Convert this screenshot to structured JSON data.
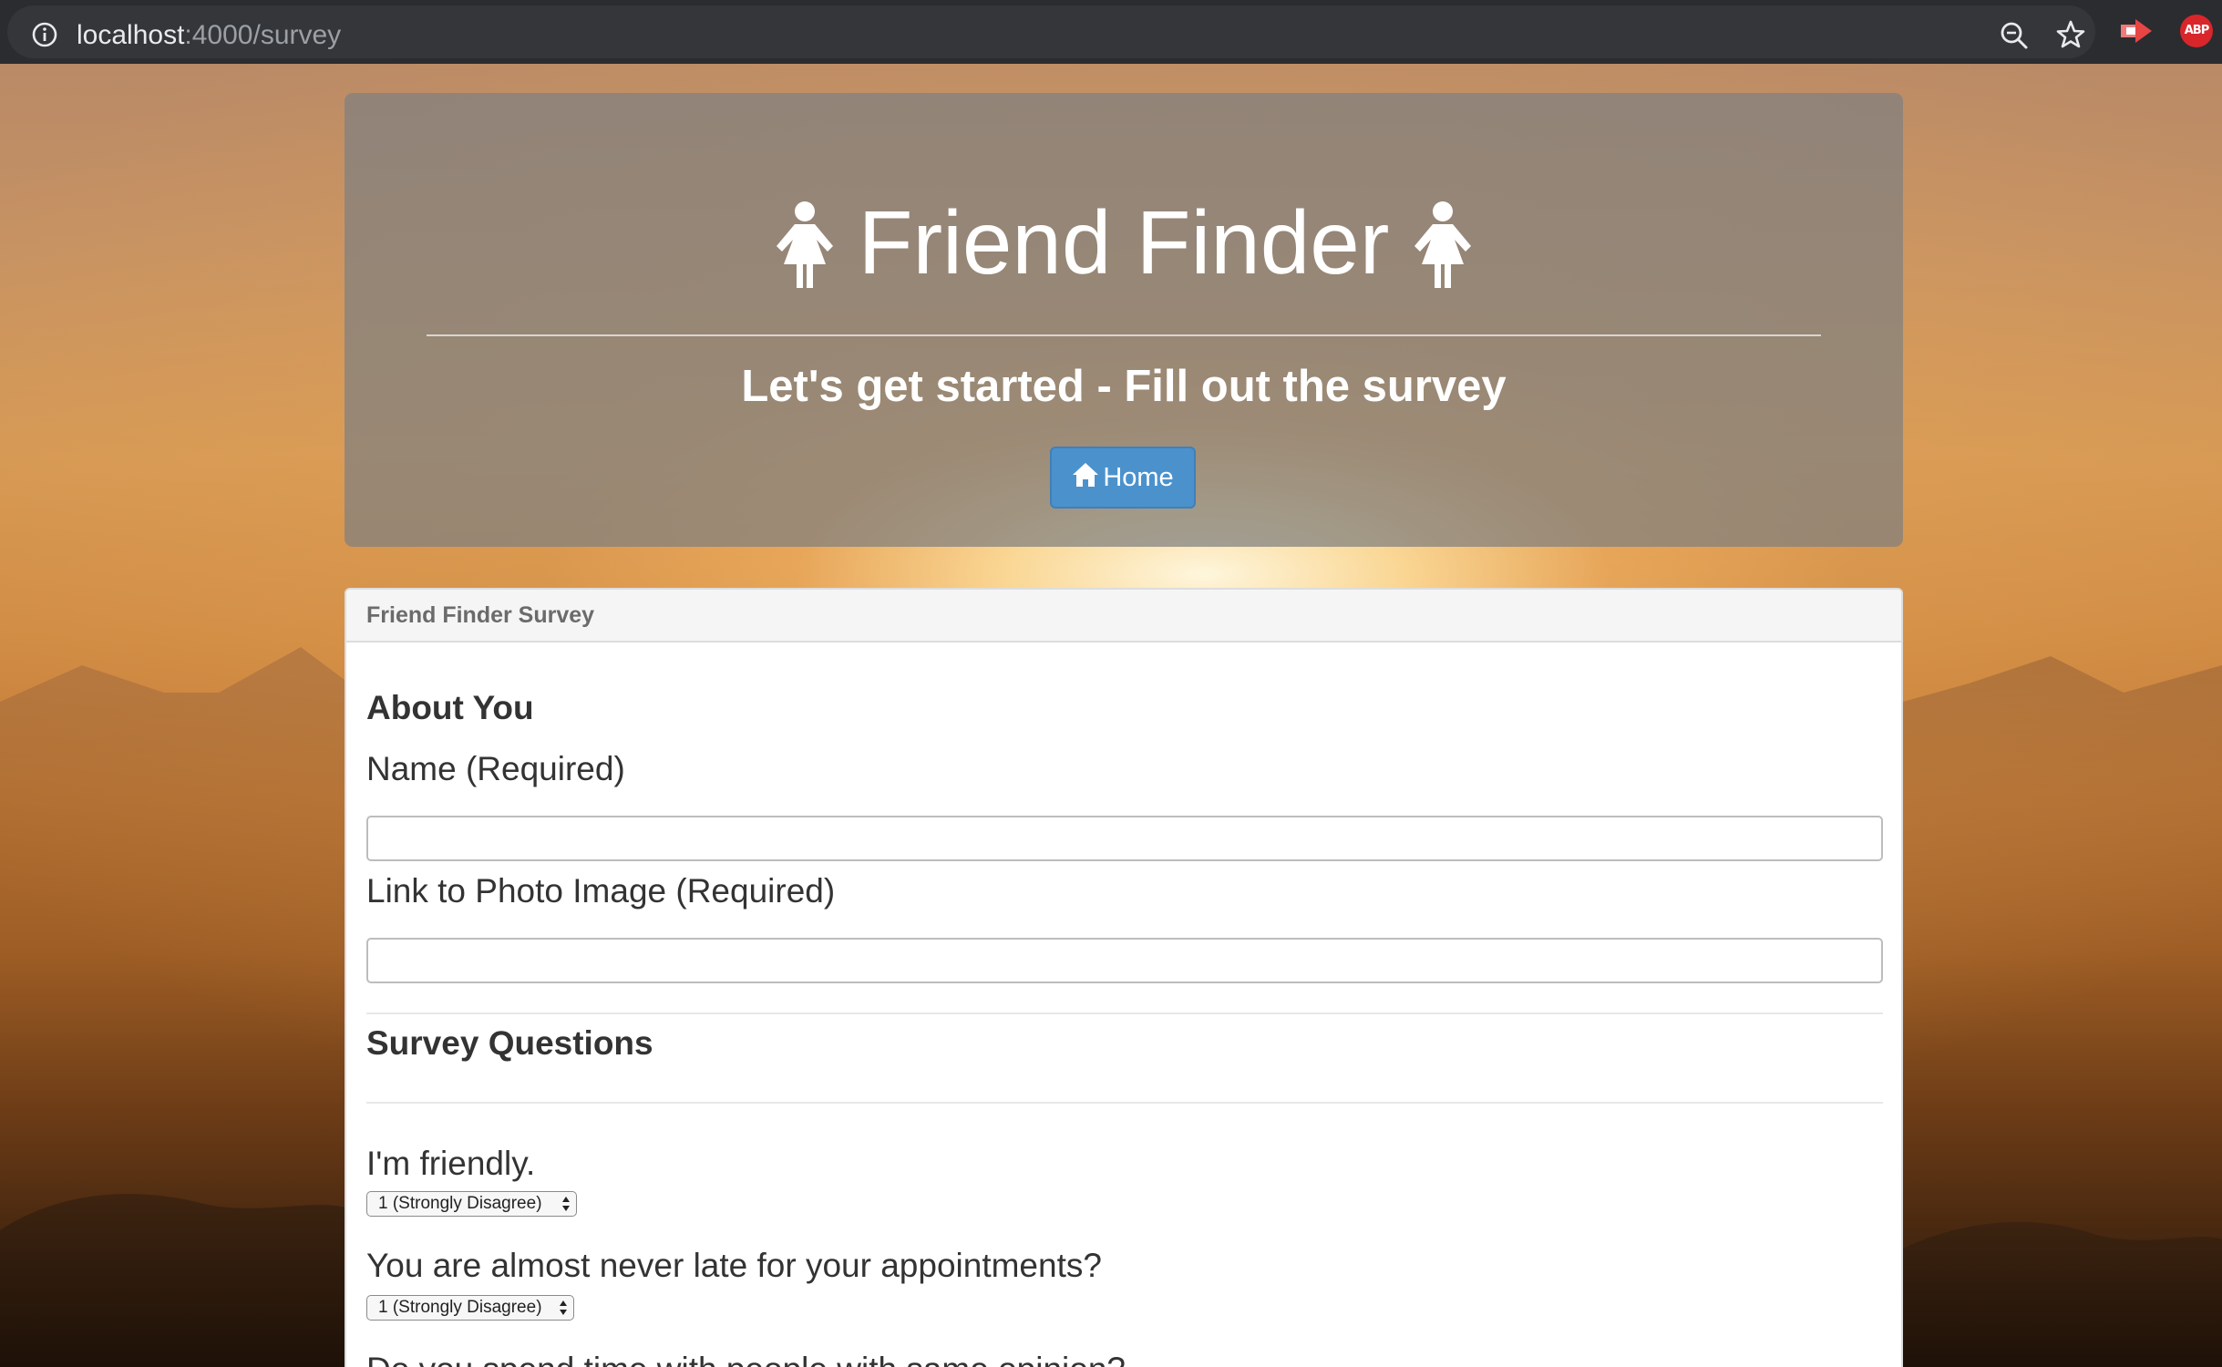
{
  "browser": {
    "url_host": "localhost",
    "url_path": ":4000/survey",
    "abp_label": "ABP"
  },
  "header": {
    "title": "Friend Finder",
    "subtitle": "Let's get started - Fill out the survey",
    "home_button": "Home"
  },
  "panel": {
    "heading": "Friend Finder Survey",
    "about_heading": "About You",
    "name_label": "Name (Required)",
    "name_value": "",
    "photo_label": "Link to Photo Image (Required)",
    "photo_value": "",
    "survey_heading": "Survey Questions",
    "questions": [
      {
        "text": "I'm friendly.",
        "selected": "1 (Strongly Disagree)"
      },
      {
        "text": "You are almost never late for your appointments?",
        "selected": "1 (Strongly Disagree)"
      },
      {
        "text": "Do you spend time with people with same opinion?"
      }
    ]
  },
  "colors": {
    "jumbotron_bg": "#808080",
    "home_button_bg": "#4b92cd",
    "panel_heading_bg": "#f5f5f5",
    "abp_red": "#d9262b"
  },
  "icons": [
    "info-icon",
    "zoom-icon",
    "star-icon",
    "extension-icon",
    "abp-icon",
    "female-person-icon",
    "house-icon",
    "select-arrows-icon"
  ]
}
